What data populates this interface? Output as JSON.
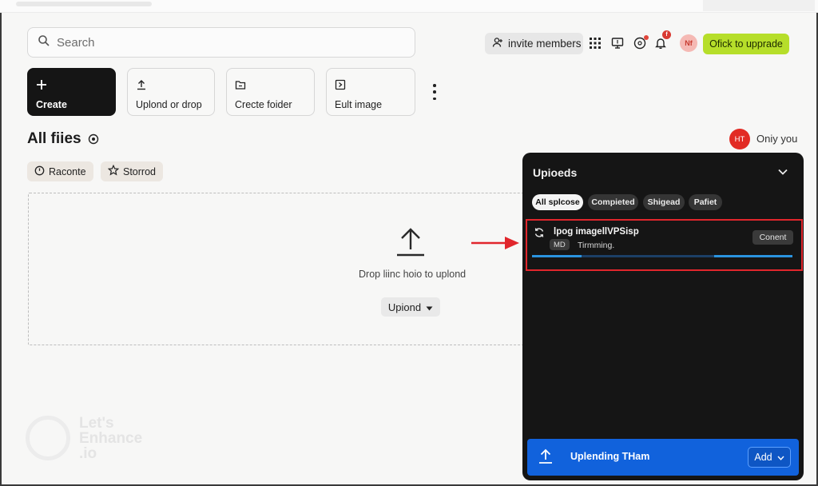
{
  "search": {
    "placeholder": "Search"
  },
  "header": {
    "invite_label": "invite members",
    "notification_count": "f",
    "avatar_initials": "Nf",
    "upgrade_label": "Ofick to upprade"
  },
  "actions": {
    "create_label": "Create",
    "upload_label": "Uplond or drop",
    "folder_label": "Crecte foider",
    "edit_label": "Eult image"
  },
  "files": {
    "title": "All fiies",
    "owner_initials": "HT",
    "visibility": "Oniy you",
    "filters": [
      "Raconte",
      "Storrod"
    ]
  },
  "dropzone": {
    "text": "Drop liinc hoio to uplond",
    "button_label": "Upiond"
  },
  "watermark": {
    "line1": "Let's",
    "line2": "Enhance",
    "line3": ".io"
  },
  "panel": {
    "title": "Upioeds",
    "tabs": [
      "All splcose",
      "Compieted",
      "Shigead",
      "Pafiet"
    ],
    "upload": {
      "filename": "lpog imagellVPSisp",
      "size": "MD",
      "status": "Tirmming.",
      "cancel_label": "Conent",
      "progress": 0.7
    },
    "footer_text": "Uplending THam",
    "add_label": "Add"
  },
  "colors": {
    "upgrade": "#b6de2a",
    "panel_bg": "#151515",
    "footer": "#1162dc",
    "highlight": "#e1262c"
  }
}
